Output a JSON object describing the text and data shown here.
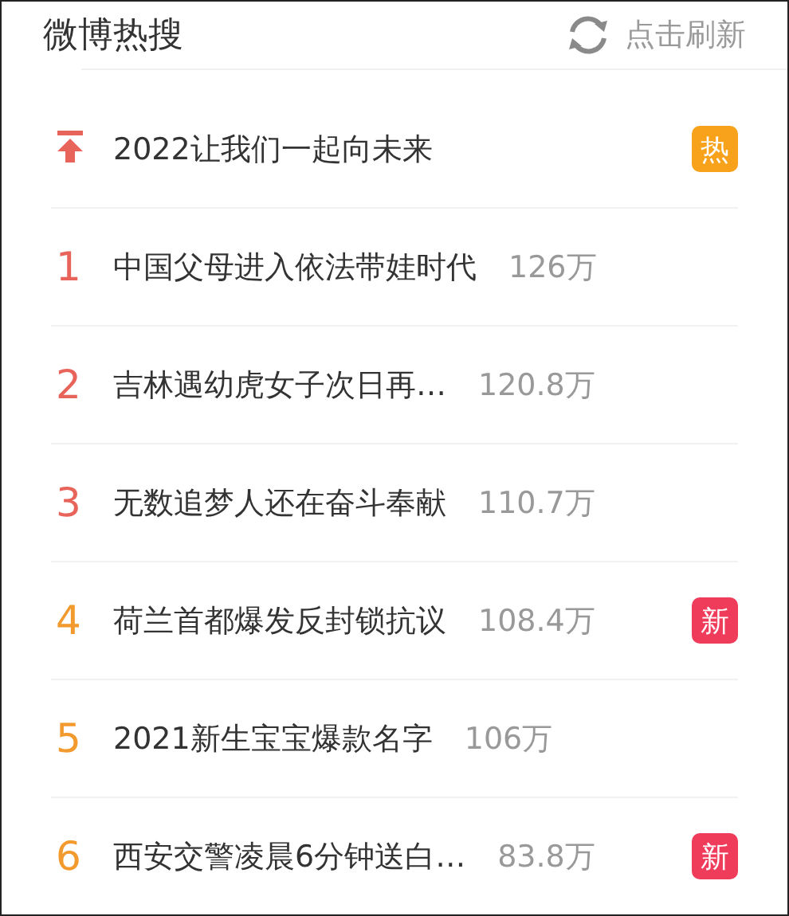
{
  "header": {
    "title": "微博热搜",
    "refresh_label": "点击刷新"
  },
  "items": [
    {
      "kind": "pinned",
      "title": "2022让我们一起向未来",
      "badge": {
        "kind": "hot",
        "label": "热"
      }
    },
    {
      "kind": "ranked",
      "rank": "1",
      "title": "中国父母进入依法带娃时代",
      "count": "126万"
    },
    {
      "kind": "ranked",
      "rank": "2",
      "title": "吉林遇幼虎女子次日再…",
      "count": "120.8万"
    },
    {
      "kind": "ranked",
      "rank": "3",
      "title": "无数追梦人还在奋斗奉献",
      "count": "110.7万"
    },
    {
      "kind": "ranked",
      "rank": "4",
      "title": "荷兰首都爆发反封锁抗议",
      "count": "108.4万",
      "badge": {
        "kind": "new",
        "label": "新"
      }
    },
    {
      "kind": "ranked",
      "rank": "5",
      "title": "2021新生宝宝爆款名字",
      "count": "106万"
    },
    {
      "kind": "ranked",
      "rank": "6",
      "title": "西安交警凌晨6分钟送白…",
      "count": "83.8万",
      "badge": {
        "kind": "new",
        "label": "新"
      }
    }
  ]
}
